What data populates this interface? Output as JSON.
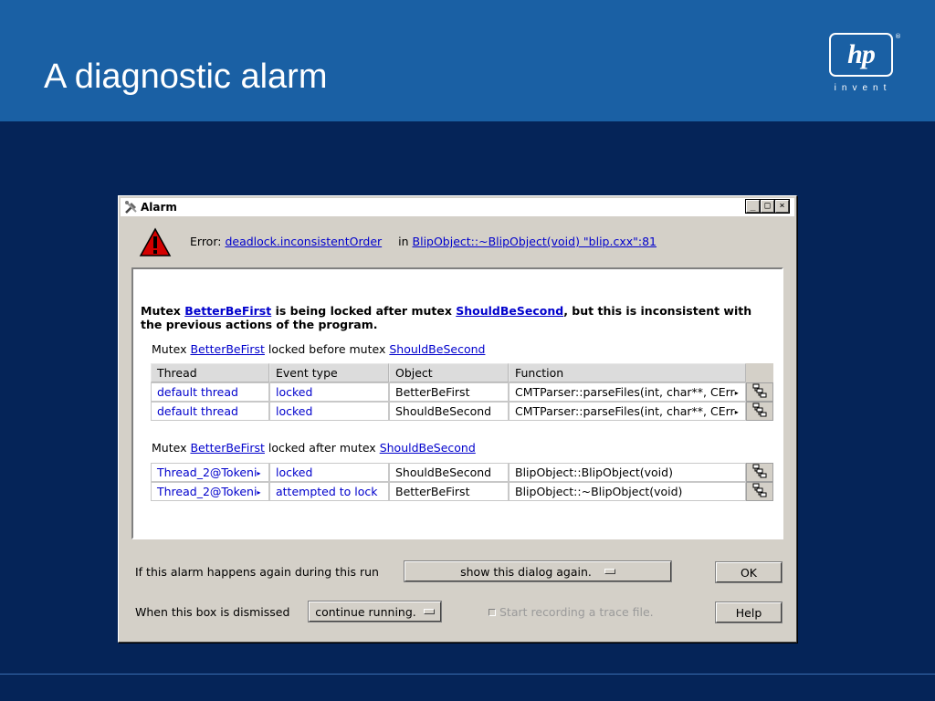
{
  "slide": {
    "title": "A diagnostic alarm",
    "logo": {
      "mark": "hp",
      "registered": "®",
      "tagline": "invent"
    },
    "colors": {
      "background": "#052458",
      "header": "#1a60a4"
    }
  },
  "dialog": {
    "title": "Alarm",
    "window_buttons": [
      "_",
      "□",
      "×"
    ],
    "error": {
      "prefix": "Error:",
      "code": "deadlock.inconsistentOrder",
      "in_label": "in",
      "location": "BlipObject::~BlipObject(void) \"blip.cxx\":81"
    },
    "summary": {
      "p1": "Mutex ",
      "m1": "BetterBeFirst",
      "p2": " is being locked after mutex ",
      "m2": "ShouldBeSecond",
      "p3": ", but this is inconsistent with the previous actions of the program."
    },
    "headers": [
      "Thread",
      "Event type",
      "Object",
      "Function"
    ],
    "sections": [
      {
        "heading": {
          "p1": "Mutex ",
          "m1": "BetterBeFirst",
          "p2": " locked before mutex ",
          "m2": "ShouldBeSecond"
        },
        "rows": [
          {
            "thread": "default thread",
            "event": "locked",
            "object": "BetterBeFirst",
            "function": "CMTParser::parseFiles(int, char**, CErr"
          },
          {
            "thread": "default thread",
            "event": "locked",
            "object": "ShouldBeSecond",
            "function": "CMTParser::parseFiles(int, char**, CErr"
          }
        ]
      },
      {
        "heading": {
          "p1": "Mutex ",
          "m1": "BetterBeFirst",
          "p2": " locked after mutex ",
          "m2": "ShouldBeSecond"
        },
        "rows": [
          {
            "thread": "Thread_2@Tokeni",
            "event": "locked",
            "object": "ShouldBeSecond",
            "function": "BlipObject::BlipObject(void)"
          },
          {
            "thread": "Thread_2@Tokeni",
            "event": "attempted to lock",
            "object": "BetterBeFirst",
            "function": "BlipObject::~BlipObject(void)"
          }
        ]
      }
    ],
    "controls": {
      "repeat_label": "If this alarm happens again during this run",
      "repeat_value": "show this dialog again.",
      "dismiss_label": "When this box is dismissed",
      "dismiss_value": "continue running.",
      "trace_label": "Start recording a trace file.",
      "ok_label": "OK",
      "help_label": "Help"
    },
    "icons": {
      "title": "alarm-tools-icon",
      "warning": "warning-triangle-icon",
      "row_action": "stack-trace-icon",
      "truncated": "truncation-arrow-icon"
    }
  }
}
